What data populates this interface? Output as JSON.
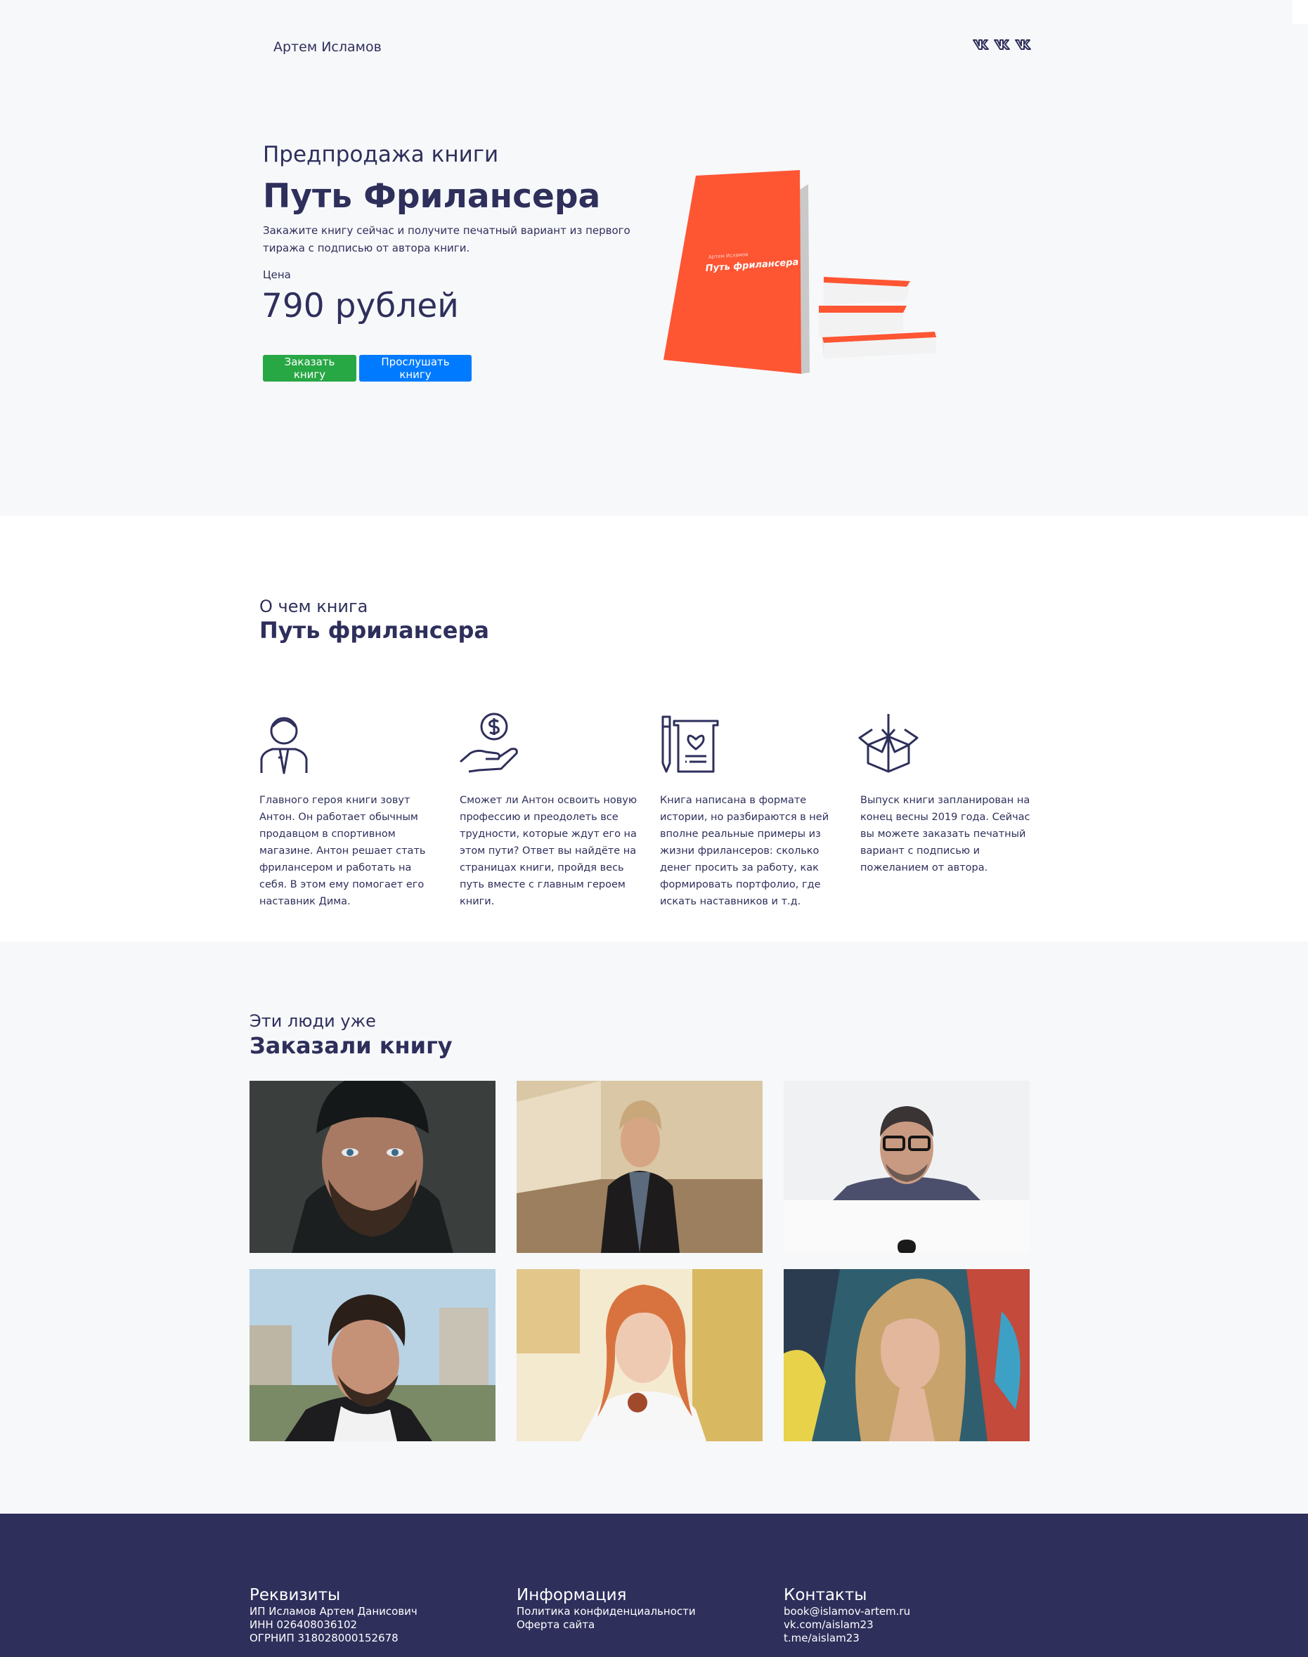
{
  "header": {
    "author": "Артем Исламов",
    "social_icons": [
      "vk-icon",
      "vk-icon",
      "vk-icon"
    ]
  },
  "hero": {
    "subtitle": "Предпродажа книги",
    "title": "Путь Фрилансера",
    "description": "Закажите книгу сейчас и получите печатный вариант из первого тиража с подписью от автора книги.",
    "price_label": "Цена",
    "price": "790 рублей",
    "order_button": "Заказать книгу",
    "listen_button": "Прослушать книгу",
    "book_cover_small": "Артем Исламов",
    "book_cover_title": "Путь фрилансера",
    "colors": {
      "order": "#28a745",
      "listen": "#007bff",
      "book": "#fe5533"
    }
  },
  "about": {
    "subtitle": "О чем книга",
    "title": "Путь фрилансера",
    "features": [
      {
        "icon": "person-with-tie-icon",
        "text": "Главного героя книги зовут Антон. Он работает обычным продавцом в спортивном магазине. Антон решает стать фрилансером и работать на себя. В этом ему помогает его наставник Дима."
      },
      {
        "icon": "hand-with-coin-icon",
        "text": "Сможет ли Антон освоить новую профессию и преодолеть все трудности, которые ждут его на этом пути? Ответ вы найдёте на страницах книги, пройдя весь путь вместе с главным героем книги."
      },
      {
        "icon": "pen-and-scroll-icon",
        "text": "Книга написана в формате истории, но разбираются в ней вполне реальные примеры из жизни фрилансеров: сколько денег просить за работу, как формировать портфолио, где искать наставников и т.д."
      },
      {
        "icon": "open-box-icon",
        "text": "Выпуск книги запланирован на конец весны 2019 года. Сейчас вы можете заказать печатный вариант с подписью и пожеланием от автора."
      }
    ]
  },
  "people": {
    "subtitle": "Эти люди уже",
    "title": "Заказали книгу"
  },
  "footer": {
    "requisites": {
      "title": "Реквизиты",
      "lines": [
        "ИП Исламов Артем Данисович",
        "ИНН 026408036102",
        "ОГРНИП 318028000152678"
      ]
    },
    "info": {
      "title": "Информация",
      "links": [
        "Политика конфиденциальности",
        "Оферта сайта"
      ]
    },
    "contacts": {
      "title": "Контакты",
      "links": [
        "book@islamov-artem.ru",
        "vk.com/aislam23",
        "t.me/aislam23"
      ]
    }
  }
}
